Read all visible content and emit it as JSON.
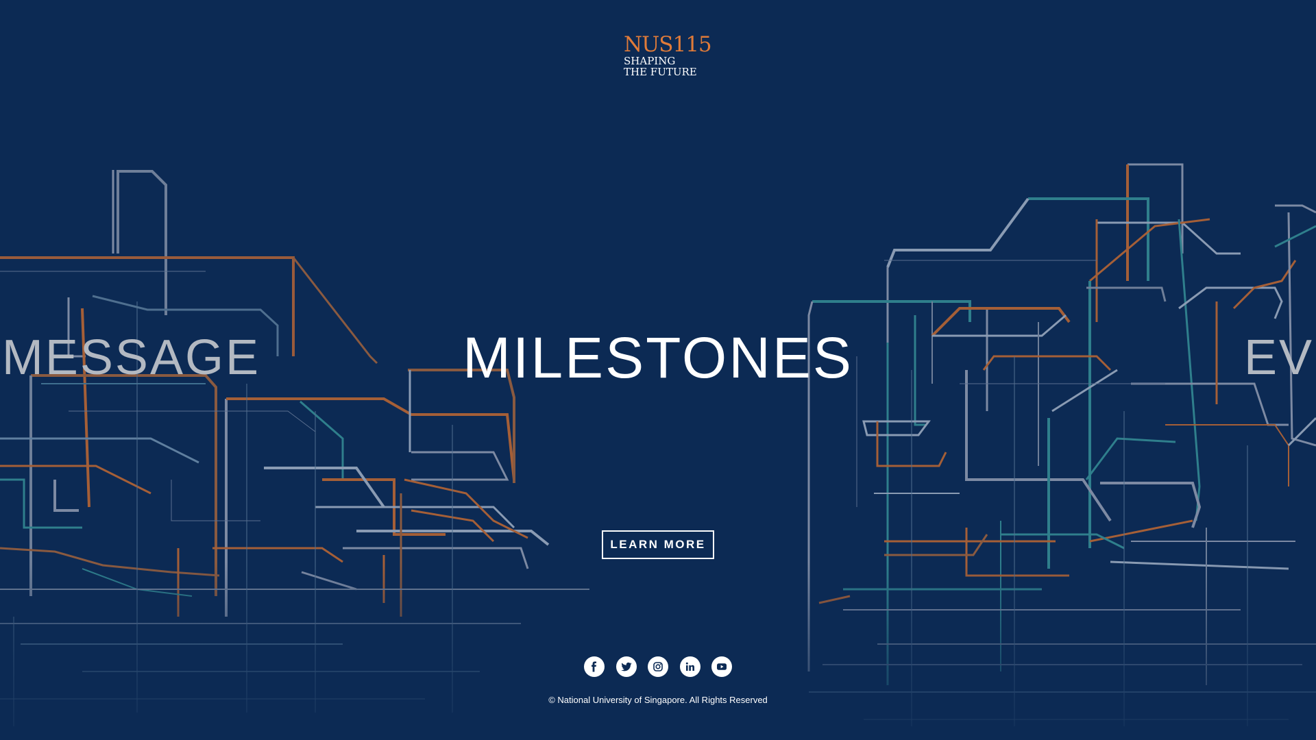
{
  "logo": {
    "brand": "NUS115",
    "line1": "SHAPING",
    "line2": "THE FUTURE",
    "brand_color": "#e07b39"
  },
  "carousel": {
    "prev_title": "S MESSAGE",
    "current_title": "MILESTONES",
    "next_title": "EVI",
    "cta_label": "LEARN MORE"
  },
  "social": [
    {
      "name": "facebook",
      "icon": "facebook-icon"
    },
    {
      "name": "twitter",
      "icon": "twitter-icon"
    },
    {
      "name": "instagram",
      "icon": "instagram-icon"
    },
    {
      "name": "linkedin",
      "icon": "linkedin-icon"
    },
    {
      "name": "youtube",
      "icon": "youtube-icon"
    }
  ],
  "footer": {
    "copyright": "© National University of Singapore. All Rights Reserved"
  },
  "colors": {
    "background": "#0c2a54",
    "line_orange": "#b5653a",
    "line_teal": "#2f7f8c",
    "line_grey": "#8a9bb3"
  }
}
